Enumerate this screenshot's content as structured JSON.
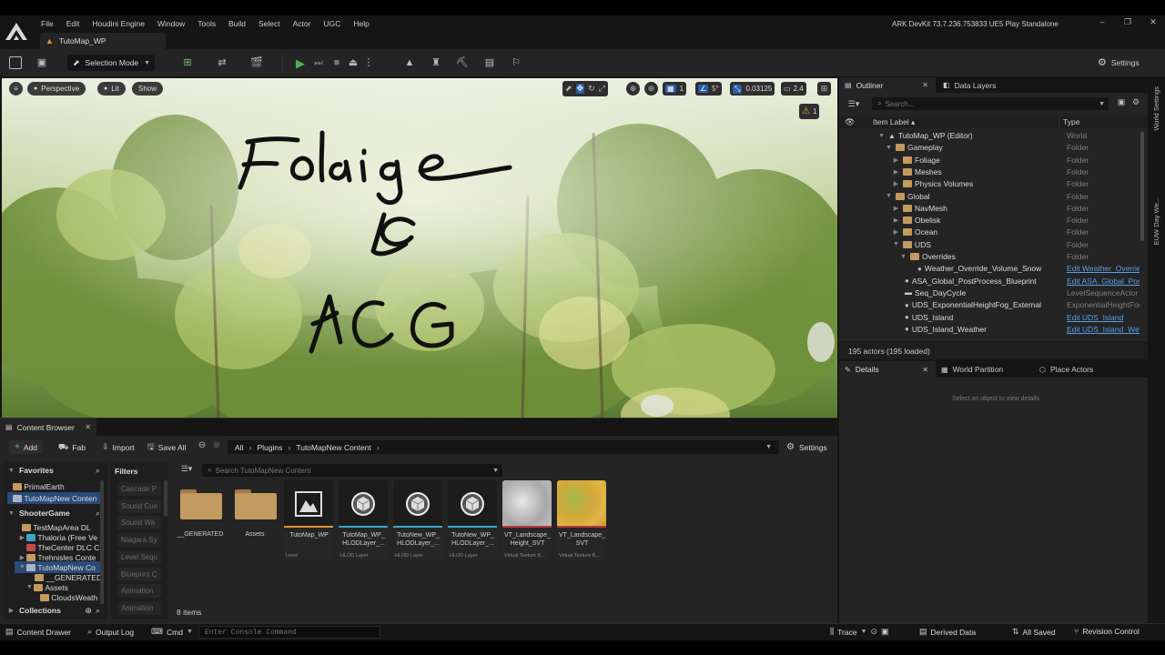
{
  "title_bar": {
    "menus": [
      "File",
      "Edit",
      "Houdini Engine",
      "Window",
      "Tools",
      "Build",
      "Select",
      "Actor",
      "UGC",
      "Help"
    ],
    "project_info": "ARK DevKit 73.7.236.753833 UE5 Play Standalone",
    "minimize": "–",
    "maximize": "❐",
    "close": "✕"
  },
  "level_tab": {
    "label": "TutoMap_WP"
  },
  "toolbar": {
    "selection_mode": "Selection Mode",
    "settings": "Settings"
  },
  "viewport": {
    "perspective": "Perspective",
    "lit": "Lit",
    "show": "Show",
    "grid_size": "1",
    "angle": "5°",
    "scale": "0.03125",
    "camera_speed": "2.4",
    "warning_count": "1",
    "overlay_line1": "Foliage",
    "overlay_line2": "&",
    "overlay_line3": "PCG"
  },
  "outliner": {
    "tab_outliner": "Outliner",
    "tab_data_layers": "Data Layers",
    "search_placeholder": "Search...",
    "col_label": "Item Label ▴",
    "col_type": "Type",
    "footer": "195 actors (195 loaded)",
    "rows": [
      {
        "label": "TutoMap_WP (Editor)",
        "type": "World",
        "link": false
      },
      {
        "label": "Gameplay",
        "type": "Folder",
        "link": false
      },
      {
        "label": "Foliage",
        "type": "Folder",
        "link": false
      },
      {
        "label": "Meshes",
        "type": "Folder",
        "link": false
      },
      {
        "label": "Physics Volumes",
        "type": "Folder",
        "link": false
      },
      {
        "label": "Global",
        "type": "Folder",
        "link": false
      },
      {
        "label": "NavMesh",
        "type": "Folder",
        "link": false
      },
      {
        "label": "Obelisk",
        "type": "Folder",
        "link": false
      },
      {
        "label": "Ocean",
        "type": "Folder",
        "link": false
      },
      {
        "label": "UDS",
        "type": "Folder",
        "link": false
      },
      {
        "label": "Overrides",
        "type": "Folder",
        "link": false
      },
      {
        "label": "Weather_Override_Volume_Snow",
        "type": "Edit Weather_Overrie",
        "link": true
      },
      {
        "label": "ASA_Global_PostProcess_Blueprint",
        "type": "Edit ASA_Global_Pos",
        "link": true
      },
      {
        "label": "Seq_DayCycle",
        "type": "LevelSequenceActor",
        "link": false
      },
      {
        "label": "UDS_ExponentialHeightFog_External",
        "type": "ExponentialHeightFog",
        "link": false
      },
      {
        "label": "UDS_Island",
        "type": "Edit UDS_Island",
        "link": true
      },
      {
        "label": "UDS_Island_Weather",
        "type": "Edit UDS_Island_Wea",
        "link": true
      }
    ]
  },
  "side_tabs": {
    "world_settings": "World Settings",
    "euw": "EUW Day We..."
  },
  "details": {
    "tab_details": "Details",
    "tab_world_partition": "World Partition",
    "tab_place_actors": "Place Actors",
    "empty_msg": "Select an object to view details"
  },
  "content_browser": {
    "tab": "Content Browser",
    "add": "Add",
    "fab": "Fab",
    "import": "Import",
    "save_all": "Save All",
    "breadcrumb": [
      "All",
      "Plugins",
      "TutoMapNew Content"
    ],
    "settings": "Settings",
    "search_placeholder": "Search TutoMapNew Content",
    "filters_label": "Filters",
    "item_count": "8 items",
    "favorites_label": "Favorites",
    "favorites": [
      "PrimalEarth",
      "TutoMapNew Conten"
    ],
    "shootergame_label": "ShooterGame",
    "tree": [
      "TestMapArea DL",
      "Thaloria (Free Ve",
      "TheCenter DLC C",
      "Trehnisles Conte",
      "TutoMapNew Co",
      "__GENERATED",
      "Assets",
      "CloudsWeath"
    ],
    "collections_label": "Collections",
    "filters": [
      "Cascade P",
      "Sound Cue",
      "Sound Wa",
      "Niagara Sy",
      "Level Sequ",
      "Blueprint C",
      "Animation",
      "Animation"
    ],
    "assets": [
      {
        "name": "__GENERATED",
        "kind": "",
        "thumb": "folder",
        "stripe": ""
      },
      {
        "name": "Assets",
        "kind": "",
        "thumb": "folder",
        "stripe": ""
      },
      {
        "name": "TutoMap_WP",
        "kind": "Level",
        "thumb": "level",
        "stripe": "#e09438"
      },
      {
        "name": "TutoMap_WP_HLODLayer_...",
        "kind": "HLOD Layer",
        "thumb": "hlod",
        "stripe": "#3aa6c8"
      },
      {
        "name": "TutoNew_WP_HLODLayer_...",
        "kind": "HLOD Layer",
        "thumb": "hlod",
        "stripe": "#3aa6c8"
      },
      {
        "name": "TutoNew_WP_HLODLayer_...",
        "kind": "HLOD Layer",
        "thumb": "hlod",
        "stripe": "#3aa6c8"
      },
      {
        "name": "VT_Landscape_Height_SVT",
        "kind": "Virtual Texture B...",
        "thumb": "vt_height",
        "stripe": "#b23a3a"
      },
      {
        "name": "VT_Landscape_SVT",
        "kind": "Virtual Texture B...",
        "thumb": "vt_color",
        "stripe": "#b23a3a"
      }
    ]
  },
  "status_bar": {
    "content_drawer": "Content Drawer",
    "output_log": "Output Log",
    "cmd": "Cmd",
    "console_placeholder": "Enter Console Command",
    "trace": "Trace",
    "derived_data": "Derived Data",
    "all_saved": "All Saved",
    "revision_control": "Revision Control"
  },
  "colors": {
    "accent_green": "#4caf50",
    "link_blue": "#5b9ee6",
    "folder": "#c39a5f",
    "selection": "#2a4a78"
  }
}
